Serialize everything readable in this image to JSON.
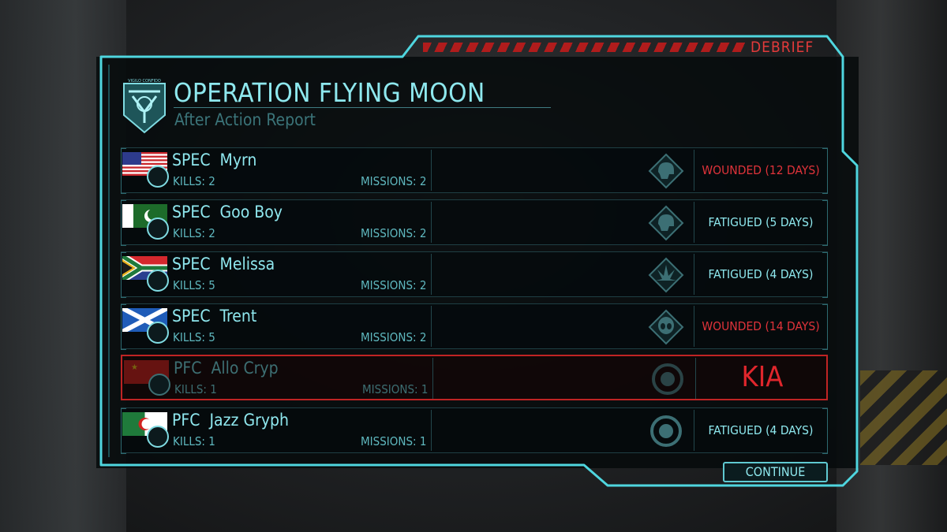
{
  "header": {
    "tab_label": "DEBRIEF",
    "title": "OPERATION FLYING MOON",
    "subtitle": "After Action Report",
    "badge_icon": "xcom-badge-icon",
    "badge_motto": "VIGILO CONFIDO"
  },
  "colors": {
    "accent": "#8ee8ee",
    "frame": "#4fd6df",
    "wounded": "#e0333a",
    "fatigued": "#8ee8ee",
    "kia": "#e0262c"
  },
  "soldiers": [
    {
      "rank": "SPEC",
      "name": "Myrn",
      "flag": "usa-flag-icon",
      "kills_label": "KILLS: 2",
      "missions_label": "MISSIONS: 2",
      "class_icon": "assault-helmet-icon",
      "status": "WOUNDED (12 DAYS)",
      "status_type": "wounded"
    },
    {
      "rank": "SPEC",
      "name": "Goo Boy",
      "flag": "pakistan-flag-icon",
      "kills_label": "KILLS: 2",
      "missions_label": "MISSIONS: 2",
      "class_icon": "assault-helmet-icon",
      "status": "FATIGUED (5 DAYS)",
      "status_type": "fatigued"
    },
    {
      "rank": "SPEC",
      "name": "Melissa",
      "flag": "south-africa-flag-icon",
      "kills_label": "KILLS: 5",
      "missions_label": "MISSIONS: 2",
      "class_icon": "support-burst-icon",
      "status": "FATIGUED (4 DAYS)",
      "status_type": "fatigued"
    },
    {
      "rank": "SPEC",
      "name": "Trent",
      "flag": "scotland-flag-icon",
      "kills_label": "KILLS: 5",
      "missions_label": "MISSIONS: 2",
      "class_icon": "alien-head-icon",
      "status": "WOUNDED (14 DAYS)",
      "status_type": "wounded"
    },
    {
      "rank": "PFC",
      "name": "Allo Cryp",
      "flag": "china-flag-icon",
      "kills_label": "KILLS: 1",
      "missions_label": "MISSIONS: 1",
      "class_icon": "rookie-circle-icon",
      "status": "KIA",
      "status_type": "kia"
    },
    {
      "rank": "PFC",
      "name": "Jazz Gryph",
      "flag": "algeria-flag-icon",
      "kills_label": "KILLS: 1",
      "missions_label": "MISSIONS: 1",
      "class_icon": "rookie-circle-icon",
      "status": "FATIGUED (4 DAYS)",
      "status_type": "fatigued"
    }
  ],
  "footer": {
    "continue_label": "CONTINUE"
  }
}
